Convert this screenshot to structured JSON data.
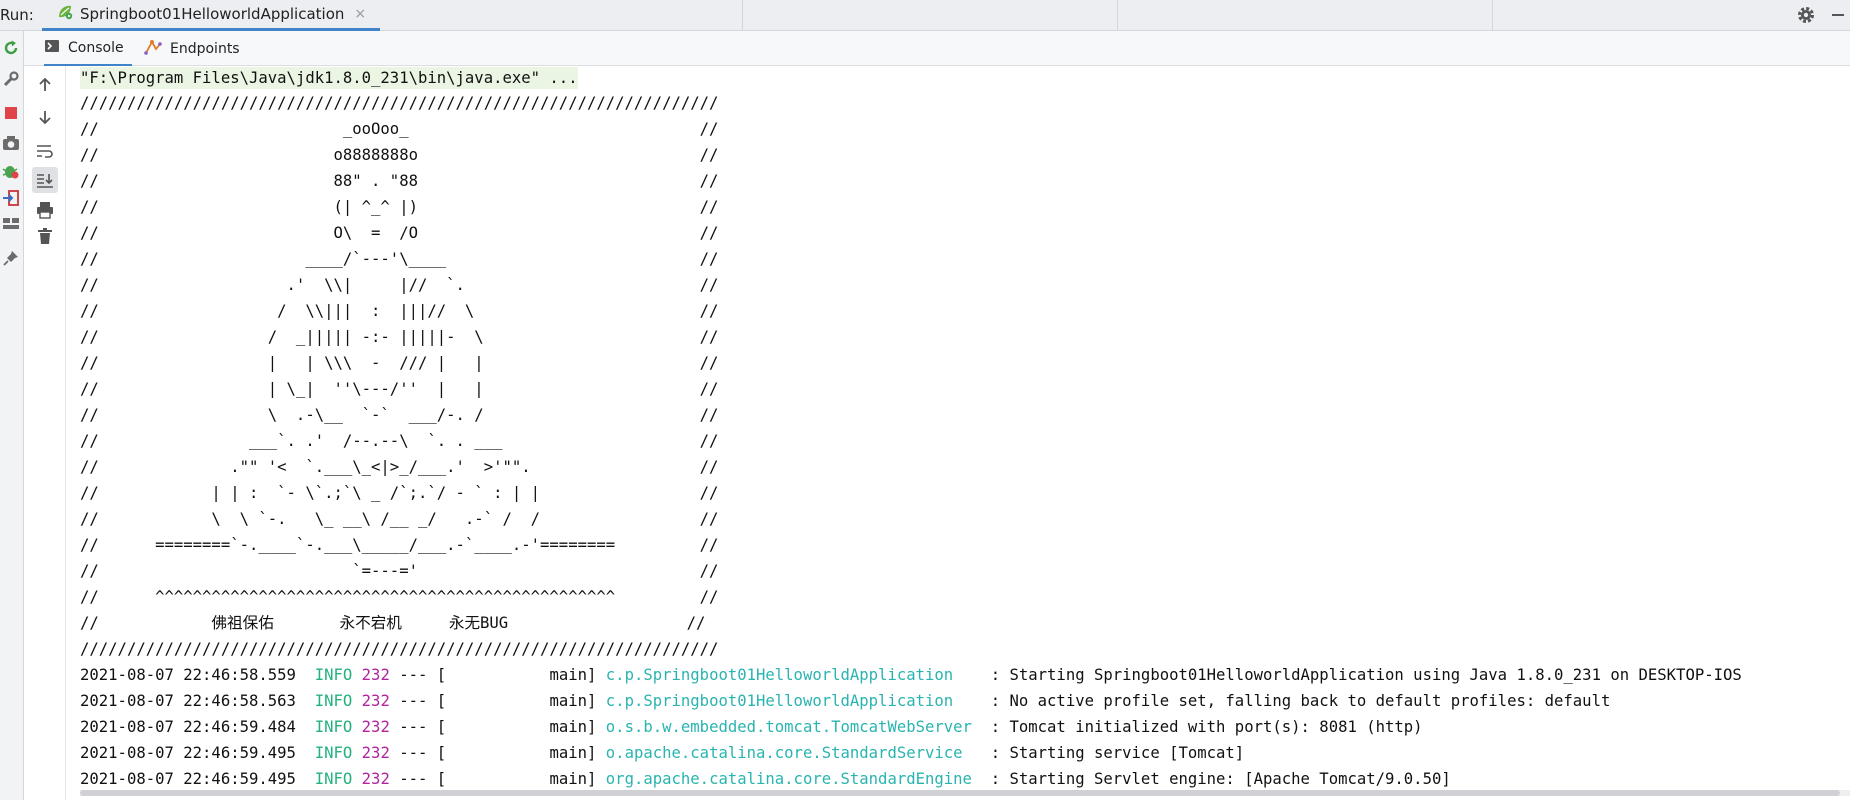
{
  "run_bar": {
    "label": "Run:",
    "tab_title": "Springboot01HelloworldApplication",
    "close_glyph": "×"
  },
  "sub_tabs": [
    {
      "label": "Console",
      "icon": "console-icon",
      "active": true
    },
    {
      "label": "Endpoints",
      "icon": "endpoints-icon",
      "active": false
    }
  ],
  "left_toolbar": [
    "rerun-icon",
    "wrench-icon",
    "stop-icon",
    "camera-icon",
    "debug-bug-icon",
    "login-icon",
    "layout-icon",
    "pin-icon"
  ],
  "console_toolbar": [
    "arrow-up-icon",
    "arrow-down-icon",
    "soft-wrap-icon",
    "scroll-to-end-icon",
    "print-icon",
    "trash-icon"
  ],
  "console": {
    "command": "\"F:\\Program Files\\Java\\jdk1.8.0_231\\bin\\java.exe\" ...",
    "banner": [
      "////////////////////////////////////////////////////////////////////",
      "//                          _ooOoo_                               //",
      "//                         o8888888o                              //",
      "//                         88\" . \"88                              //",
      "//                         (| ^_^ |)                              //",
      "//                         O\\  =  /O                              //",
      "//                      ____/`---'\\____                           //",
      "//                    .'  \\\\|     |//  `.                         //",
      "//                   /  \\\\|||  :  |||//  \\                        //",
      "//                  /  _||||| -:- |||||-  \\                       //",
      "//                  |   | \\\\\\  -  /// |   |                       //",
      "//                  | \\_|  ''\\---/''  |   |                       //",
      "//                  \\  .-\\__  `-`  ___/-. /                       //",
      "//                ___`. .'  /--.--\\  `. . ___                     //",
      "//              .\"\" '<  `.___\\_<|>_/___.'  >'\"\".                  //",
      "//            | | :  `- \\`.;`\\ _ /`;.`/ - ` : | |                 //",
      "//            \\  \\ `-.   \\_ __\\ /__ _/   .-` /  /                 //",
      "//      ========`-.____`-.___\\_____/___.-`____.-'========         //",
      "//                           `=---='                              //",
      "//      ^^^^^^^^^^^^^^^^^^^^^^^^^^^^^^^^^^^^^^^^^^^^^^^^^         //",
      "//            佛祖保佑       永不宕机     永无BUG                   //",
      "////////////////////////////////////////////////////////////////////"
    ],
    "logs": [
      {
        "time": "2021-08-07 22:46:58.559",
        "level": "INFO",
        "pid": "232",
        "sep": "---",
        "thread": "[           main]",
        "logger": "c.p.Springboot01HelloworldApplication   ",
        "message": " : Starting Springboot01HelloworldApplication using Java 1.8.0_231 on DESKTOP-IOS"
      },
      {
        "time": "2021-08-07 22:46:58.563",
        "level": "INFO",
        "pid": "232",
        "sep": "---",
        "thread": "[           main]",
        "logger": "c.p.Springboot01HelloworldApplication   ",
        "message": " : No active profile set, falling back to default profiles: default"
      },
      {
        "time": "2021-08-07 22:46:59.484",
        "level": "INFO",
        "pid": "232",
        "sep": "---",
        "thread": "[           main]",
        "logger": "o.s.b.w.embedded.tomcat.TomcatWebServer ",
        "message": " : Tomcat initialized with port(s): 8081 (http)"
      },
      {
        "time": "2021-08-07 22:46:59.495",
        "level": "INFO",
        "pid": "232",
        "sep": "---",
        "thread": "[           main]",
        "logger": "o.apache.catalina.core.StandardService  ",
        "message": " : Starting service [Tomcat]"
      },
      {
        "time": "2021-08-07 22:46:59.495",
        "level": "INFO",
        "pid": "232",
        "sep": "---",
        "thread": "[           main]",
        "logger": "org.apache.catalina.core.StandardEngine ",
        "message": " : Starting Servlet engine: [Apache Tomcat/9.0.50]"
      }
    ]
  }
}
